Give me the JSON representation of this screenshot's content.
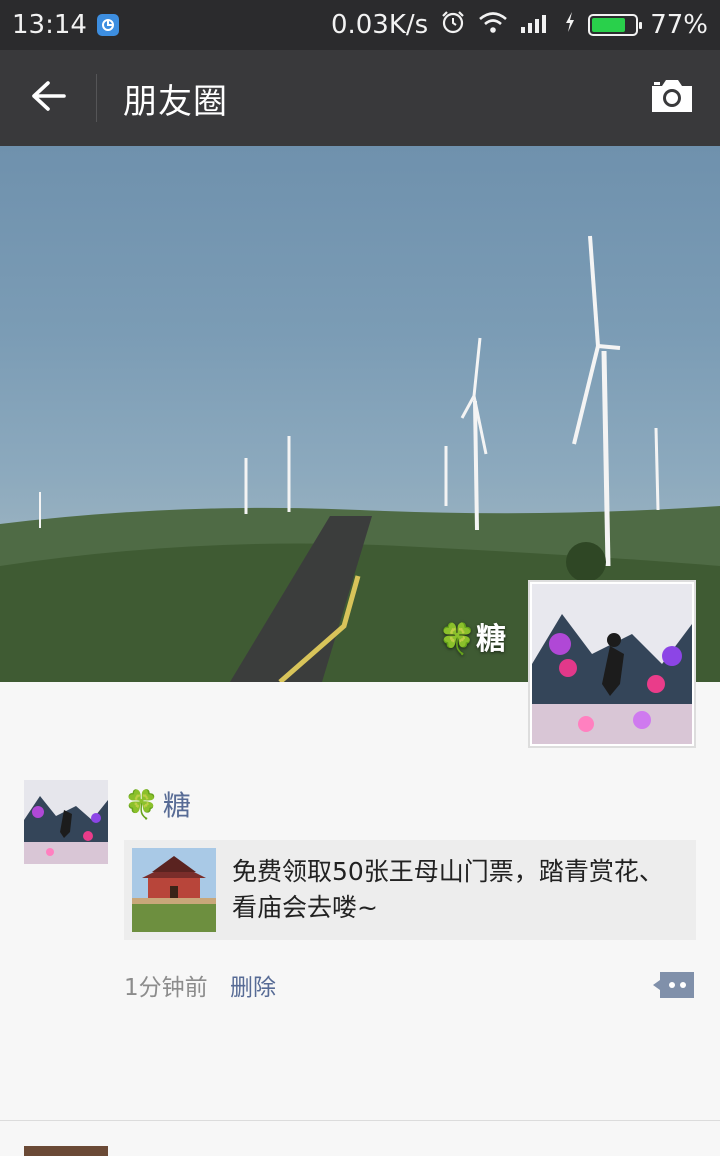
{
  "status_bar": {
    "time": "13:14",
    "network_speed": "0.03K/s",
    "battery_percent": "77%",
    "battery_level": 0.77,
    "icons": [
      "app-notification-icon",
      "alarm-icon",
      "wifi-icon",
      "signal-icon",
      "charging-icon",
      "battery-icon"
    ]
  },
  "title_bar": {
    "title": "朋友圈",
    "back_icon": "back-arrow-icon",
    "camera_icon": "camera-icon"
  },
  "cover": {
    "user_name": "糖",
    "emoji": "🍀"
  },
  "post": {
    "author": "糖",
    "author_emoji": "🍀",
    "share_text": "免费领取50张王母山门票，踏青赏花、看庙会去喽~",
    "time": "1分钟前",
    "delete_label": "删除",
    "comment_icon": "comment-icon"
  },
  "colors": {
    "title_bar": "#39393b",
    "status_bar": "#2b2b2d",
    "link": "#576b95",
    "battery": "#29d04b"
  }
}
